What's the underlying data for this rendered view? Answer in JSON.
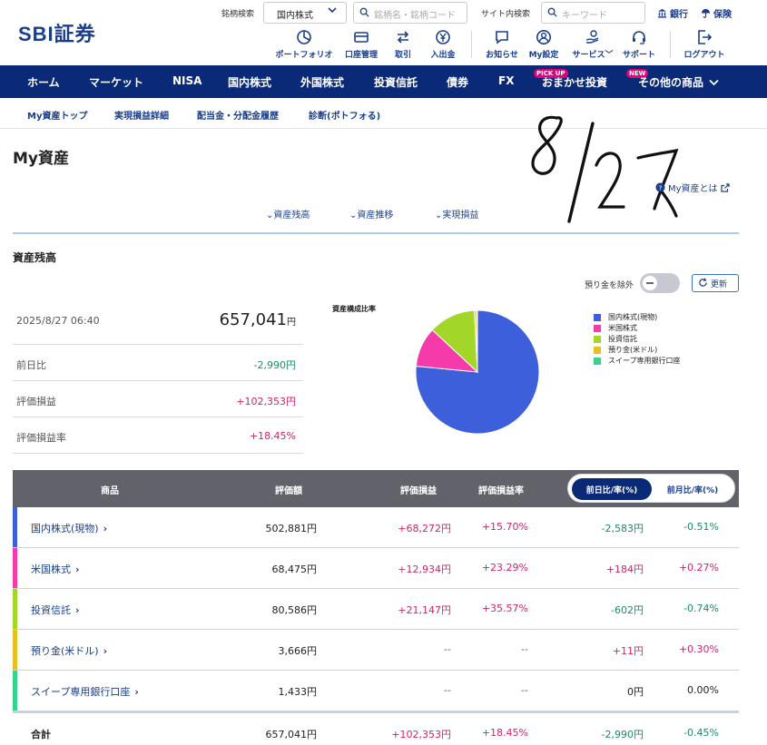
{
  "header": {
    "logo": "SBI証券",
    "symbol_search_label": "銘柄検索",
    "market_select": "国内株式",
    "symbol_search_placeholder": "銘柄名・銘柄コード",
    "site_search_label": "サイト内検索",
    "site_search_placeholder": "キーワード",
    "bank_link": "銀行",
    "insurance_link": "保険",
    "tools": [
      {
        "label": "ポートフォリオ"
      },
      {
        "label": "口座管理"
      },
      {
        "label": "取引"
      },
      {
        "label": "入出金"
      },
      {
        "label": "お知らせ"
      },
      {
        "label": "My設定"
      },
      {
        "label": "サービス"
      },
      {
        "label": "サポート"
      },
      {
        "label": "ログアウト"
      }
    ]
  },
  "nav": {
    "items": [
      {
        "label": "ホーム"
      },
      {
        "label": "マーケット"
      },
      {
        "label": "NISA"
      },
      {
        "label": "国内株式"
      },
      {
        "label": "外国株式"
      },
      {
        "label": "投資信託"
      },
      {
        "label": "債券"
      },
      {
        "label": "FX"
      },
      {
        "label": "おまかせ投資",
        "badge": "PICK UP"
      },
      {
        "label": "その他の商品",
        "badge": "NEW"
      }
    ]
  },
  "subnav": {
    "items": [
      {
        "label": "My資産トップ"
      },
      {
        "label": "実現損益詳細"
      },
      {
        "label": "配当金・分配金履歴"
      },
      {
        "label": "診断(ポトフォる)"
      }
    ]
  },
  "page": {
    "title": "My資産",
    "about_link": "My資産とは",
    "anchors": [
      {
        "label": "資産残高"
      },
      {
        "label": "資産推移"
      },
      {
        "label": "実現損益"
      }
    ]
  },
  "balance": {
    "section_title": "資産残高",
    "exclude_deposit_label": "預り金を除外",
    "refresh_label": "更新",
    "datetime": "2025/8/27 06:40",
    "total_value": "657,041",
    "total_unit": "円",
    "rows": [
      {
        "label": "前日比",
        "value": "-2,990円",
        "sign": "neg"
      },
      {
        "label": "評価損益",
        "value": "+102,353円",
        "sign": "pos"
      },
      {
        "label": "評価損益率",
        "value": "+18.45%",
        "sign": "pos"
      }
    ]
  },
  "chart_data": {
    "type": "pie",
    "title": "資産構成比率",
    "categories": [
      "国内株式(現物)",
      "米国株式",
      "投資信託",
      "預り金(米ドル)",
      "スイープ専用銀行口座"
    ],
    "values": [
      502881,
      68475,
      80586,
      3666,
      1433
    ],
    "colors": [
      "#3d5fd9",
      "#f53aa9",
      "#a2d72a",
      "#e5c021",
      "#35d48c"
    ],
    "legend_position": "right"
  },
  "holdings": {
    "columns": [
      "商品",
      "評価額",
      "評価損益",
      "評価損益率"
    ],
    "period_active": "前日比/率(%)",
    "period_inactive": "前月比/率(%)",
    "rows": [
      {
        "name": "国内株式(現物)",
        "color": "#3d5fd9",
        "value": "502,881円",
        "pl": "+68,272円",
        "pl_sign": "pos",
        "pl_rate": "+15.70%",
        "rate_sign": "pos",
        "chg": "-2,583円",
        "chg_sign": "neg",
        "chg_rate": "-0.51%",
        "chgr_sign": "neg"
      },
      {
        "name": "米国株式",
        "color": "#f53aa9",
        "value": "68,475円",
        "pl": "+12,934円",
        "pl_sign": "pos",
        "pl_rate": "+23.29%",
        "rate_sign": "pos",
        "chg": "+184円",
        "chg_sign": "pos",
        "chg_rate": "+0.27%",
        "chgr_sign": "pos"
      },
      {
        "name": "投資信託",
        "color": "#a2d72a",
        "value": "80,586円",
        "pl": "+21,147円",
        "pl_sign": "pos",
        "pl_rate": "+35.57%",
        "rate_sign": "pos",
        "chg": "-602円",
        "chg_sign": "neg",
        "chg_rate": "-0.74%",
        "chgr_sign": "neg"
      },
      {
        "name": "預り金(米ドル)",
        "color": "#e5c021",
        "value": "3,666円",
        "pl": "--",
        "pl_sign": "dash",
        "pl_rate": "--",
        "rate_sign": "dash",
        "chg": "+11円",
        "chg_sign": "pos",
        "chg_rate": "+0.30%",
        "chgr_sign": "pos"
      },
      {
        "name": "スイープ専用銀行口座",
        "color": "#35d48c",
        "value": "1,433円",
        "pl": "--",
        "pl_sign": "dash",
        "pl_rate": "--",
        "rate_sign": "dash",
        "chg": "0円",
        "chg_sign": "neu",
        "chg_rate": "0.00%",
        "chgr_sign": "neu"
      }
    ],
    "total": {
      "name": "合計",
      "value": "657,041円",
      "pl": "+102,353円",
      "pl_rate": "+18.45%",
      "chg": "-2,990円",
      "chg_rate": "-0.45%"
    }
  },
  "handwritten_note": "8/27"
}
